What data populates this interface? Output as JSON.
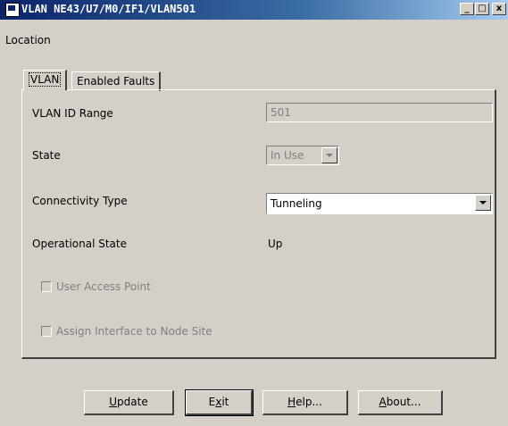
{
  "window": {
    "title": "VLAN NE43/U7/M0/IF1/VLAN501",
    "controls": {
      "minimize": "_",
      "maximize": "□",
      "close": "x"
    }
  },
  "menu": {
    "items": [
      "Location"
    ]
  },
  "tabs": [
    {
      "label": "VLAN",
      "active": true
    },
    {
      "label": "Enabled Faults",
      "active": false
    }
  ],
  "form": {
    "vlan_id_range": {
      "label": "VLAN ID Range",
      "value": "501"
    },
    "state": {
      "label": "State",
      "value": "In Use"
    },
    "connectivity_type": {
      "label": "Connectivity Type",
      "value": "Tunneling"
    },
    "operational_state": {
      "label": "Operational State",
      "value": "Up"
    },
    "user_access_point": {
      "label": "User Access Point",
      "checked": false,
      "enabled": false
    },
    "assign_interface": {
      "label": "Assign Interface to Node Site",
      "checked": false,
      "enabled": false
    }
  },
  "buttons": {
    "update": {
      "label": "Update",
      "mnemonic": "U"
    },
    "exit": {
      "label": "Exit",
      "mnemonic": "x"
    },
    "help": {
      "label": "Help...",
      "mnemonic": "H"
    },
    "about": {
      "label": "About...",
      "mnemonic": "A"
    }
  },
  "colors": {
    "face": "#d4d0c8",
    "title_start": "#0a246a",
    "title_end": "#a6caf0",
    "disabled_text": "#808080"
  }
}
